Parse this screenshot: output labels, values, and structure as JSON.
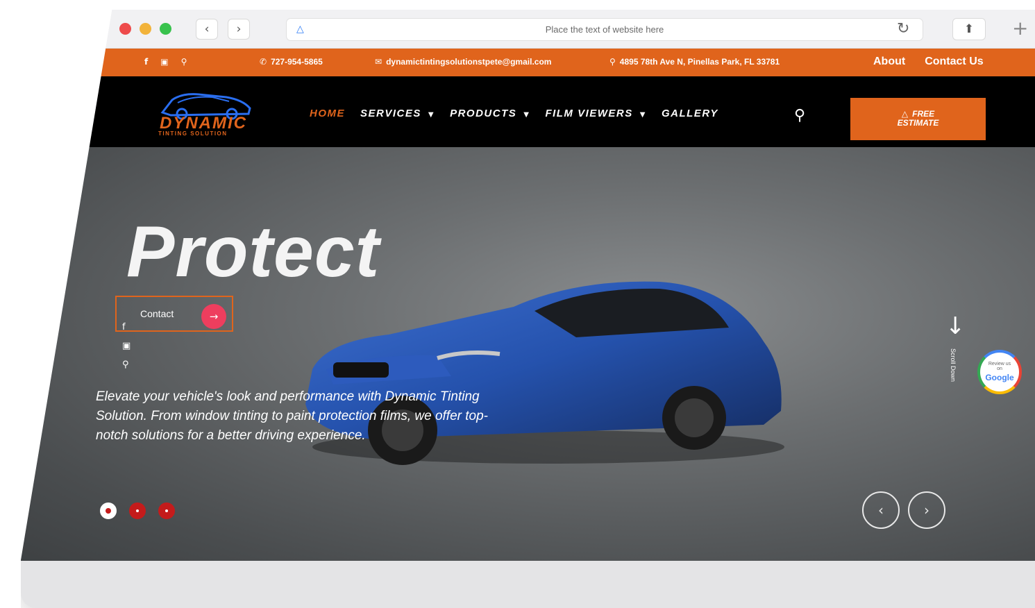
{
  "browser": {
    "address_text": "Place the text of website here",
    "back_icon": "chevron-left-icon",
    "forward_icon": "chevron-right-icon"
  },
  "topbar": {
    "phone": "727-954-5865",
    "email": "dynamictintingsolutionstpete@gmail.com",
    "address": "4895 78th Ave N, Pinellas Park, FL 33781",
    "about_label": "About",
    "contact_label": "Contact Us",
    "bg_color": "#e0641c"
  },
  "navbar": {
    "logo_text": "DYNAMIC",
    "logo_sub": "TINTING SOLUTION",
    "menu": [
      {
        "label": "HOME"
      },
      {
        "label": "SERVICES"
      },
      {
        "label": "PRODUCTS"
      },
      {
        "label": "FILM VIEWERS"
      },
      {
        "label": "GALLERY"
      }
    ],
    "estimate_line1": "FREE",
    "estimate_line2": "ESTIMATE"
  },
  "hero": {
    "title": "Protect",
    "contact_label": "Contact",
    "description": "Elevate your vehicle's look and performance with Dynamic Tinting Solution. From window tinting to paint protection films, we offer top-notch solutions for a better driving experience.",
    "scroll_label": "Scroll Down",
    "badge_line1": "Review us",
    "badge_line2": "on",
    "badge_brand": "Google",
    "slides_total": 3,
    "active_slide": 1
  }
}
